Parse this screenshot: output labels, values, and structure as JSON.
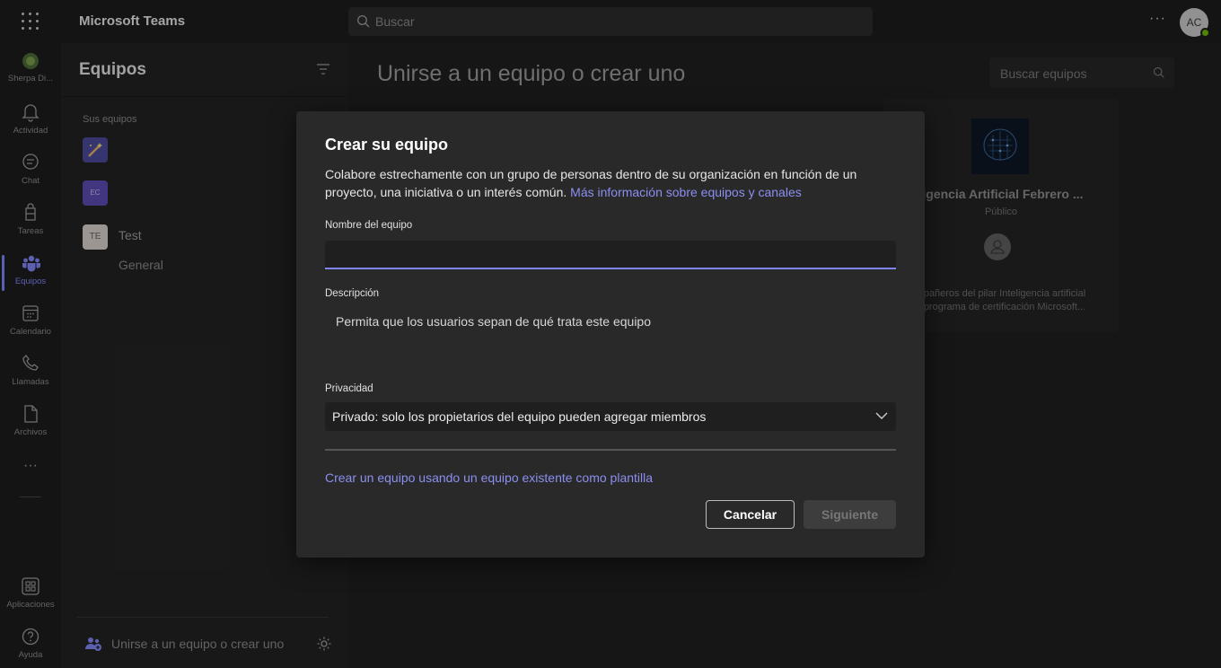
{
  "titlebar": {
    "app_title": "Microsoft Teams",
    "search_placeholder": "Buscar",
    "more_label": "···",
    "avatar_initials": "AC"
  },
  "rail": {
    "items": [
      {
        "label": "Sherpa Di...",
        "icon": "org-avatar-icon"
      },
      {
        "label": "Actividad",
        "icon": "bell-icon"
      },
      {
        "label": "Chat",
        "icon": "chat-icon"
      },
      {
        "label": "Tareas",
        "icon": "tasks-icon"
      },
      {
        "label": "Equipos",
        "icon": "teams-icon",
        "active": true
      },
      {
        "label": "Calendario",
        "icon": "calendar-icon"
      },
      {
        "label": "Llamadas",
        "icon": "phone-icon"
      },
      {
        "label": "Archivos",
        "icon": "file-icon"
      },
      {
        "label": "Aplicaciones",
        "icon": "apps-icon"
      },
      {
        "label": "Ayuda",
        "icon": "help-icon"
      }
    ],
    "more_label": "···"
  },
  "panel": {
    "title": "Equipos",
    "section_label": "Sus equipos",
    "teams": [
      {
        "name": "",
        "tile_color": "#4b4a9a",
        "icon": "wand-icon"
      },
      {
        "name": "",
        "tile_color": "#5b4bb0",
        "initials": "EC"
      },
      {
        "name": "Test",
        "tile_color": "#d8d0cc",
        "initials": "TE"
      }
    ],
    "channel": "General",
    "join_label": "Unirse a un equipo o crear uno"
  },
  "main": {
    "title": "Unirse a un equipo o crear uno",
    "search_placeholder": "Buscar equipos",
    "card": {
      "title": "ligencia Artificial Febrero ...",
      "privacy": "Público",
      "description": "pañeros del pilar Inteligencia artificial programa de certificación Microsoft..."
    }
  },
  "dialog": {
    "title": "Crear su equipo",
    "description": "Colabore estrechamente con un grupo de personas dentro de su organización en función de un proyecto, una iniciativa o un interés común.",
    "learn_more_link": "Más información sobre equipos y canales",
    "name_label": "Nombre del equipo",
    "name_value": "",
    "description_label": "Descripción",
    "description_placeholder": "Permita que los usuarios sepan de qué trata este equipo",
    "privacy_label": "Privacidad",
    "privacy_value": "Privado: solo los propietarios del equipo pueden agregar miembros",
    "template_link": "Crear un equipo usando un equipo existente como plantilla",
    "cancel_label": "Cancelar",
    "next_label": "Siguiente"
  },
  "colors": {
    "accent": "#7f85f5",
    "link": "#8b8ff0",
    "presence_available": "#6bb700"
  }
}
